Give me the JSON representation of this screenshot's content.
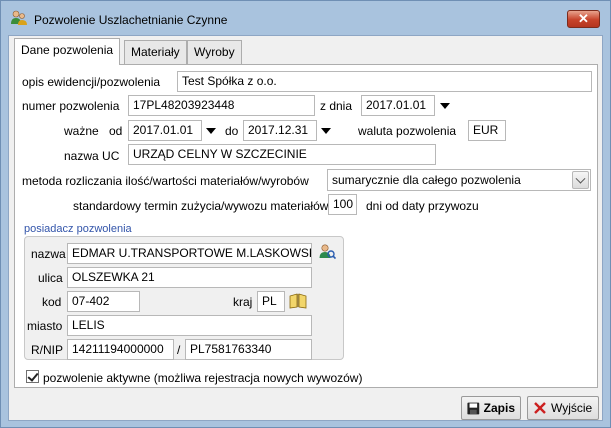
{
  "window": {
    "title": "Pozwolenie Uszlachetnianie Czynne",
    "close_glyph": "✕"
  },
  "tabs": [
    {
      "label": "Dane pozwolenia",
      "active": true
    },
    {
      "label": "Materiały",
      "active": false
    },
    {
      "label": "Wyroby",
      "active": false
    }
  ],
  "form": {
    "opis_label": "opis ewidencji/pozwolenia",
    "opis_value": "Test Spółka z o.o.",
    "numer_label": "numer pozwolenia",
    "numer_value": "17PL48203923448",
    "z_dnia_label": "z dnia",
    "z_dnia_value": "2017.01.01",
    "wazne_label": "ważne",
    "od_label": "od",
    "od_value": "2017.01.01",
    "do_label": "do",
    "do_value": "2017.12.31",
    "waluta_label": "waluta pozwolenia",
    "waluta_value": "EUR",
    "uc_label": "nazwa UC",
    "uc_value": "URZĄD CELNY W SZCZECINIE",
    "metoda_label": "metoda rozliczania ilość/wartości materiałów/wyrobów",
    "metoda_value": "sumarycznie dla całego pozwolenia",
    "termin_label": "standardowy termin zużycia/wywozu materiałów",
    "termin_value": "100",
    "termin_suffix": "dni od daty przywozu"
  },
  "posiadacz": {
    "group_title": "posiadacz pozwolenia",
    "nazwa_label": "nazwa",
    "nazwa_value": "EDMAR U.TRANSPORTOWE M.LASKOWSK",
    "ulica_label": "ulica",
    "ulica_value": "OLSZEWKA 21",
    "kod_label": "kod",
    "kod_value": "07-402",
    "kraj_label": "kraj",
    "kraj_value": "PL",
    "miasto_label": "miasto",
    "miasto_value": "LELIS",
    "rnip_label": "R/NIP",
    "regon_value": "14211194000000",
    "separator": "/",
    "nip_value": "PL7581763340"
  },
  "aktywne": {
    "label": "pozwolenie aktywne (możliwa rejestracja nowych wywozów)",
    "checked": true
  },
  "buttons": {
    "save_label": "Zapis",
    "exit_label": "Wyjście"
  },
  "colors": {
    "title_bg": "#a9c3de",
    "close_red": "#c7432a",
    "group_title": "#3355aa"
  }
}
